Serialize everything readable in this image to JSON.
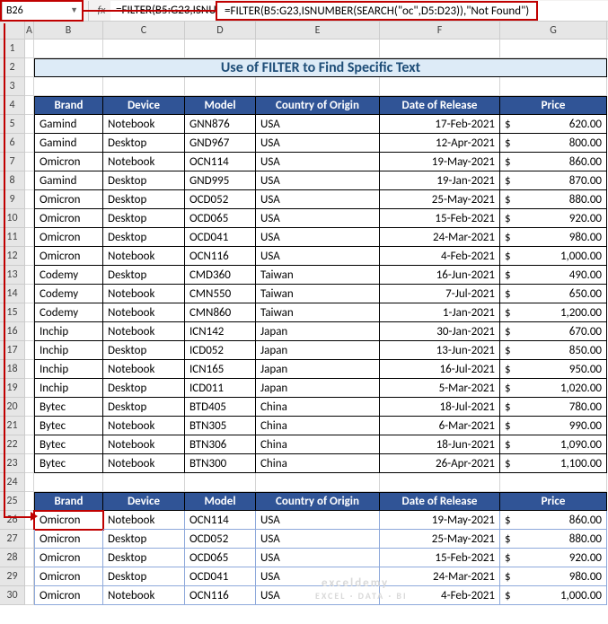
{
  "namebox": "B26",
  "formula": "=FILTER(B5:G23,ISNUMBER(SEARCH(\"oc\",D5:D23)),\"Not Found\")",
  "colHeaders": [
    "A",
    "B",
    "C",
    "D",
    "E",
    "F",
    "G"
  ],
  "rowCount": 30,
  "title": "Use of FILTER to Find Specific Text",
  "headers": {
    "brand": "Brand",
    "device": "Device",
    "model": "Model",
    "country": "Country of Origin",
    "date": "Date of Release",
    "price": "Price"
  },
  "rows": [
    {
      "brand": "Gamind",
      "device": "Notebook",
      "model": "GNN876",
      "country": "USA",
      "date": "17-Feb-2021",
      "price": "620.00"
    },
    {
      "brand": "Gamind",
      "device": "Desktop",
      "model": "GND967",
      "country": "USA",
      "date": "12-Apr-2021",
      "price": "800.00"
    },
    {
      "brand": "Omicron",
      "device": "Notebook",
      "model": "OCN114",
      "country": "USA",
      "date": "19-May-2021",
      "price": "860.00"
    },
    {
      "brand": "Gamind",
      "device": "Desktop",
      "model": "GND995",
      "country": "USA",
      "date": "19-Jan-2021",
      "price": "870.00"
    },
    {
      "brand": "Omicron",
      "device": "Desktop",
      "model": "OCD052",
      "country": "USA",
      "date": "25-May-2021",
      "price": "880.00"
    },
    {
      "brand": "Omicron",
      "device": "Desktop",
      "model": "OCD065",
      "country": "USA",
      "date": "15-Feb-2021",
      "price": "920.00"
    },
    {
      "brand": "Omicron",
      "device": "Desktop",
      "model": "OCD041",
      "country": "USA",
      "date": "24-Mar-2021",
      "price": "980.00"
    },
    {
      "brand": "Omicron",
      "device": "Notebook",
      "model": "OCN116",
      "country": "USA",
      "date": "4-Feb-2021",
      "price": "1,000.00"
    },
    {
      "brand": "Codemy",
      "device": "Desktop",
      "model": "CMD360",
      "country": "Taiwan",
      "date": "16-Jun-2021",
      "price": "490.00"
    },
    {
      "brand": "Codemy",
      "device": "Notebook",
      "model": "CMN550",
      "country": "Taiwan",
      "date": "7-Jul-2021",
      "price": "650.00"
    },
    {
      "brand": "Codemy",
      "device": "Notebook",
      "model": "CMN860",
      "country": "Taiwan",
      "date": "1-Jan-2021",
      "price": "1,200.00"
    },
    {
      "brand": "Inchip",
      "device": "Notebook",
      "model": "ICN142",
      "country": "Japan",
      "date": "30-Jan-2021",
      "price": "670.00"
    },
    {
      "brand": "Inchip",
      "device": "Desktop",
      "model": "ICD052",
      "country": "Japan",
      "date": "13-Jun-2021",
      "price": "850.00"
    },
    {
      "brand": "Inchip",
      "device": "Notebook",
      "model": "ICN165",
      "country": "Japan",
      "date": "16-Jul-2021",
      "price": "950.00"
    },
    {
      "brand": "Inchip",
      "device": "Desktop",
      "model": "ICD011",
      "country": "Japan",
      "date": "5-Mar-2021",
      "price": "1,020.00"
    },
    {
      "brand": "Bytec",
      "device": "Desktop",
      "model": "BTD405",
      "country": "China",
      "date": "18-Jul-2021",
      "price": "780.00"
    },
    {
      "brand": "Bytec",
      "device": "Notebook",
      "model": "BTN305",
      "country": "China",
      "date": "6-Mar-2021",
      "price": "990.00"
    },
    {
      "brand": "Bytec",
      "device": "Notebook",
      "model": "BTN306",
      "country": "China",
      "date": "18-Jun-2021",
      "price": "1,090.00"
    },
    {
      "brand": "Bytec",
      "device": "Notebook",
      "model": "BTN300",
      "country": "China",
      "date": "26-Apr-2021",
      "price": "1,100.00"
    }
  ],
  "filterRows": [
    {
      "brand": "Omicron",
      "device": "Notebook",
      "model": "OCN114",
      "country": "USA",
      "date": "19-May-2021",
      "price": "860.00"
    },
    {
      "brand": "Omicron",
      "device": "Desktop",
      "model": "OCD052",
      "country": "USA",
      "date": "25-May-2021",
      "price": "880.00"
    },
    {
      "brand": "Omicron",
      "device": "Desktop",
      "model": "OCD065",
      "country": "USA",
      "date": "15-Feb-2021",
      "price": "920.00"
    },
    {
      "brand": "Omicron",
      "device": "Desktop",
      "model": "OCD041",
      "country": "USA",
      "date": "24-Mar-2021",
      "price": "980.00"
    },
    {
      "brand": "Omicron",
      "device": "Notebook",
      "model": "OCN116",
      "country": "USA",
      "date": "4-Feb-2021",
      "price": "1,000.00"
    }
  ],
  "currencySymbol": "$",
  "watermark1": "exceldemy",
  "watermark2": "EXCEL · DATA · BI"
}
